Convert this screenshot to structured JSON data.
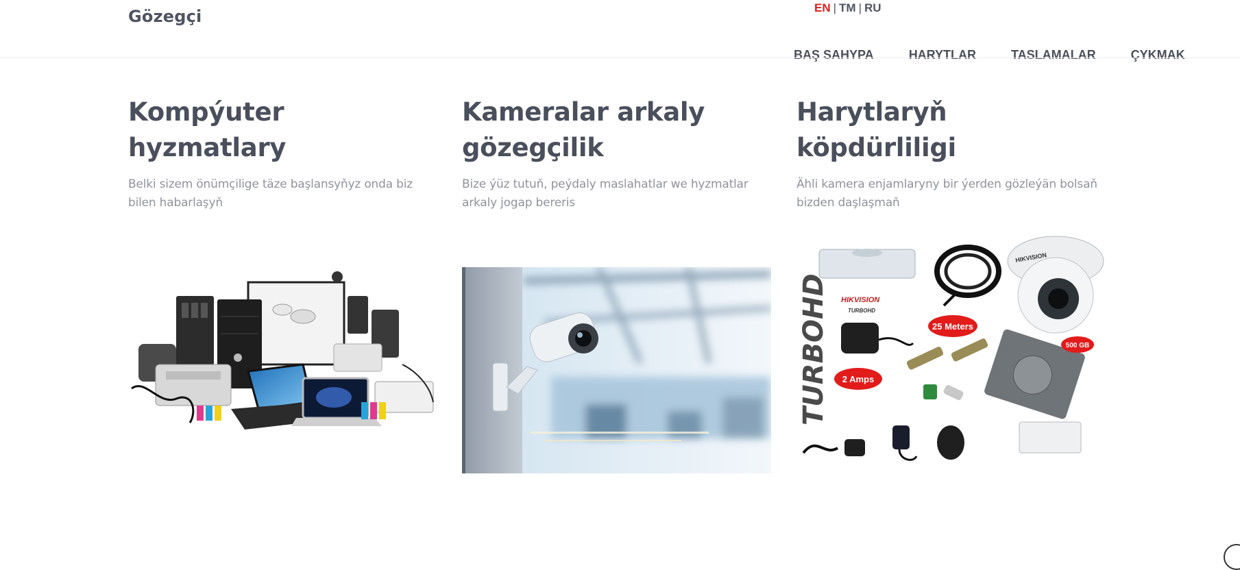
{
  "brand": {
    "name": "Gözegçi"
  },
  "languages": [
    {
      "code": "EN",
      "active": true
    },
    {
      "code": "TM",
      "active": false
    },
    {
      "code": "RU",
      "active": false
    }
  ],
  "language_separator": "|",
  "nav": {
    "items": [
      {
        "label": "BAŞ SAHYPA"
      },
      {
        "label": "HARYTLAR"
      },
      {
        "label": "TASLAMALAR"
      },
      {
        "label": "ÇYKMAK"
      }
    ]
  },
  "features": [
    {
      "title": "Kompýuter hyzmatlary",
      "text": "Belki sizem önümçilige täze başlansyňyz onda biz bilen habarlaşyň",
      "image": "computer-equipment-collage"
    },
    {
      "title": "Kameralar arkaly gözegçilik",
      "text": "Bize ýüz tutuň, peýdaly maslahatlar we hyzmatlar arkaly jogap bereris",
      "image": "security-camera-office"
    },
    {
      "title": "Harytlaryň köpdürliligi",
      "text": "Ähli kamera enjamlaryny bir ýerden gözleýän bolsaň bizden daşlaşmaň",
      "image": "cctv-kit-products"
    }
  ],
  "kit_labels": {
    "brand_vertical": "TURBOHD",
    "hikvision": "HIKVISION",
    "turbohd_small": "TURBOHD",
    "cable_badge": "25 Meters",
    "power_badge": "2 Amps",
    "hdd_badge": "500 GB",
    "dome_brand": "HIKVISION"
  },
  "colors": {
    "accent_red": "#d9231f",
    "text_dark": "#4a4f5c",
    "text_muted": "#8f939c",
    "badge_red": "#e21b1b"
  }
}
